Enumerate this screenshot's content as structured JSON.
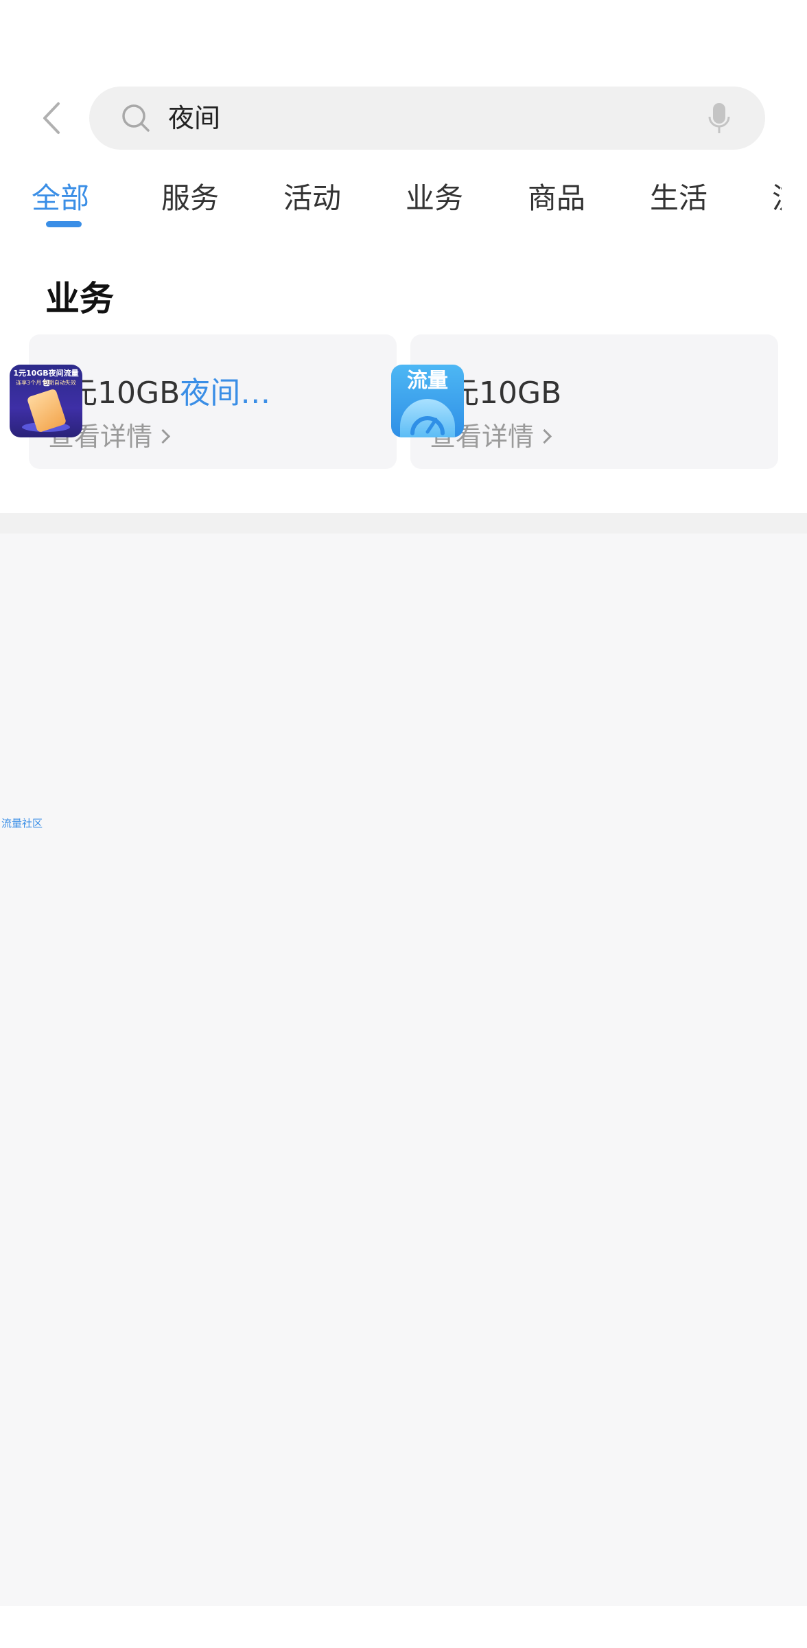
{
  "search": {
    "query": "夜间"
  },
  "tabs": [
    {
      "label": "全部",
      "active": true
    },
    {
      "label": "服务",
      "active": false
    },
    {
      "label": "活动",
      "active": false
    },
    {
      "label": "业务",
      "active": false
    },
    {
      "label": "商品",
      "active": false
    },
    {
      "label": "生活",
      "active": false
    }
  ],
  "tab_overflow_hint": "流",
  "section": {
    "title": "业务"
  },
  "cards": [
    {
      "title_prefix": "1元10GB",
      "title_highlight": "夜间…",
      "link_label": "查看详情",
      "thumb": {
        "title": "1元10GB夜间流量包",
        "subtitle": "连享3个月 到期自动失效"
      }
    },
    {
      "title_prefix": "1元10GB",
      "title_highlight": "",
      "link_label": "查看详情",
      "thumb": {
        "label": "流量"
      }
    }
  ],
  "side_link": "流量社区",
  "colors": {
    "accent": "#3a8ee6",
    "card_bg": "#f5f5f7",
    "gray_area": "#f7f7f8"
  }
}
